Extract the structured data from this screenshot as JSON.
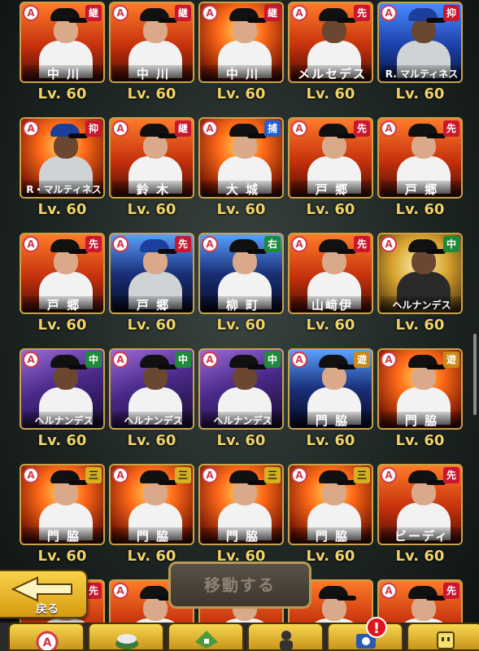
{
  "cards": [
    {
      "pos": "継",
      "pos_color": "pos-red",
      "name": "中 川",
      "level": "Lv. 60",
      "bg": "",
      "cap": "",
      "face": "",
      "body": ""
    },
    {
      "pos": "継",
      "pos_color": "pos-red",
      "name": "中 川",
      "level": "Lv. 60",
      "bg": "",
      "cap": "",
      "face": "",
      "body": ""
    },
    {
      "pos": "継",
      "pos_color": "pos-red",
      "name": "中 川",
      "level": "Lv. 60",
      "bg": "bg-fire",
      "cap": "",
      "face": "",
      "body": ""
    },
    {
      "pos": "先",
      "pos_color": "pos-red",
      "name": "メルセデス",
      "level": "Lv. 60",
      "bg": "",
      "cap": "",
      "face": "dark",
      "body": ""
    },
    {
      "pos": "抑",
      "pos_color": "pos-red",
      "name": "R. マルティネス",
      "level": "Lv. 60",
      "bg": "bg-blue",
      "cap": "blue",
      "face": "dark",
      "body": "gray"
    },
    {
      "pos": "抑",
      "pos_color": "pos-red",
      "name": "R・マルティネス",
      "level": "Lv. 60",
      "bg": "bg-fire",
      "cap": "blue",
      "face": "dark",
      "body": "gray"
    },
    {
      "pos": "継",
      "pos_color": "pos-red",
      "name": "鈴 木",
      "level": "Lv. 60",
      "bg": "",
      "cap": "",
      "face": "",
      "body": ""
    },
    {
      "pos": "捕",
      "pos_color": "pos-blue",
      "name": "大 城",
      "level": "Lv. 60",
      "bg": "bg-fire",
      "cap": "",
      "face": "",
      "body": ""
    },
    {
      "pos": "先",
      "pos_color": "pos-red",
      "name": "戸 郷",
      "level": "Lv. 60",
      "bg": "",
      "cap": "",
      "face": "",
      "body": ""
    },
    {
      "pos": "先",
      "pos_color": "pos-red",
      "name": "戸 郷",
      "level": "Lv. 60",
      "bg": "",
      "cap": "",
      "face": "",
      "body": ""
    },
    {
      "pos": "先",
      "pos_color": "pos-red",
      "name": "戸 郷",
      "level": "Lv. 60",
      "bg": "",
      "cap": "",
      "face": "",
      "body": ""
    },
    {
      "pos": "先",
      "pos_color": "pos-red",
      "name": "戸 郷",
      "level": "Lv. 60",
      "bg": "bg-night",
      "cap": "blue",
      "face": "",
      "body": "gray"
    },
    {
      "pos": "右",
      "pos_color": "pos-green",
      "name": "柳 町",
      "level": "Lv. 60",
      "bg": "bg-night",
      "cap": "",
      "face": "",
      "body": ""
    },
    {
      "pos": "先",
      "pos_color": "pos-red",
      "name": "山﨑伊",
      "level": "Lv. 60",
      "bg": "",
      "cap": "",
      "face": "",
      "body": ""
    },
    {
      "pos": "中",
      "pos_color": "pos-green",
      "name": "ヘルナンデス",
      "level": "Lv. 60",
      "bg": "bg-gold",
      "cap": "",
      "face": "dark",
      "body": "dark"
    },
    {
      "pos": "中",
      "pos_color": "pos-green",
      "name": "ヘルナンデス",
      "level": "Lv. 60",
      "bg": "bg-purple",
      "cap": "",
      "face": "dark",
      "body": ""
    },
    {
      "pos": "中",
      "pos_color": "pos-green",
      "name": "ヘルナンデス",
      "level": "Lv. 60",
      "bg": "bg-purple",
      "cap": "",
      "face": "dark",
      "body": ""
    },
    {
      "pos": "中",
      "pos_color": "pos-green",
      "name": "ヘルナンデス",
      "level": "Lv. 60",
      "bg": "bg-purple",
      "cap": "",
      "face": "dark",
      "body": ""
    },
    {
      "pos": "遊",
      "pos_color": "pos-gold",
      "name": "門 脇",
      "level": "Lv. 60",
      "bg": "bg-night",
      "cap": "",
      "face": "",
      "body": ""
    },
    {
      "pos": "遊",
      "pos_color": "pos-gold",
      "name": "門 脇",
      "level": "Lv. 60",
      "bg": "bg-fire",
      "cap": "",
      "face": "",
      "body": ""
    },
    {
      "pos": "三",
      "pos_color": "pos-yellow",
      "name": "門 脇",
      "level": "Lv. 60",
      "bg": "bg-fire",
      "cap": "",
      "face": "",
      "body": ""
    },
    {
      "pos": "三",
      "pos_color": "pos-yellow",
      "name": "門 脇",
      "level": "Lv. 60",
      "bg": "bg-fire",
      "cap": "",
      "face": "",
      "body": ""
    },
    {
      "pos": "三",
      "pos_color": "pos-yellow",
      "name": "門 脇",
      "level": "Lv. 60",
      "bg": "bg-fire",
      "cap": "",
      "face": "",
      "body": ""
    },
    {
      "pos": "三",
      "pos_color": "pos-yellow",
      "name": "門 脇",
      "level": "Lv. 60",
      "bg": "bg-fire",
      "cap": "",
      "face": "",
      "body": ""
    },
    {
      "pos": "先",
      "pos_color": "pos-red",
      "name": "ビーディ",
      "level": "Lv. 60",
      "bg": "",
      "cap": "",
      "face": "",
      "body": ""
    },
    {
      "pos": "先",
      "pos_color": "pos-red",
      "name": "",
      "level": "",
      "bg": "",
      "cap": "",
      "face": "",
      "body": ""
    },
    {
      "pos": "",
      "pos_color": "pos-red",
      "name": "",
      "level": "",
      "bg": "",
      "cap": "",
      "face": "",
      "body": ""
    },
    {
      "pos": "",
      "pos_color": "pos-red",
      "name": "",
      "level": "",
      "bg": "",
      "cap": "",
      "face": "",
      "body": ""
    },
    {
      "pos": "",
      "pos_color": "pos-red",
      "name": "",
      "level": "",
      "bg": "",
      "cap": "",
      "face": "",
      "body": ""
    },
    {
      "pos": "先",
      "pos_color": "pos-red",
      "name": "",
      "level": "",
      "bg": "",
      "cap": "",
      "face": "",
      "body": ""
    }
  ],
  "badge_a": "A",
  "back_label": "戻る",
  "move_label": "移動する",
  "alert_mark": "!",
  "tabs": [
    "a-badge-icon",
    "stadium-icon",
    "field-icon",
    "player-icon",
    "shop-icon",
    "box-icon"
  ],
  "colors": {
    "accent": "#d6b11f",
    "level_text": "#f0d36a",
    "badge_red": "#c8172e"
  }
}
